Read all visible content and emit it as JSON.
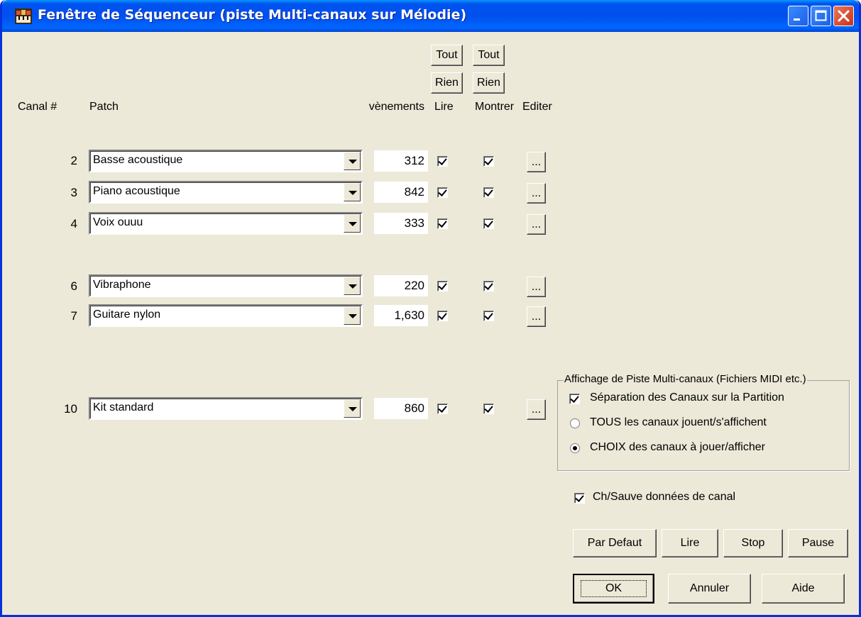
{
  "window": {
    "title": "Fenêtre de Séquenceur (piste Multi-canaux sur Mélodie)"
  },
  "header": {
    "canal": "Canal #",
    "patch": "Patch",
    "events": "vènements",
    "lire": "Lire",
    "montrer": "Montrer",
    "editer": "Editer",
    "tout": "Tout",
    "rien": "Rien"
  },
  "rows": [
    {
      "channel": "2",
      "patch": "Basse acoustique",
      "events": "312",
      "lire": true,
      "montrer": true
    },
    {
      "channel": "3",
      "patch": "Piano acoustique",
      "events": "842",
      "lire": true,
      "montrer": true
    },
    {
      "channel": "4",
      "patch": "Voix ouuu",
      "events": "333",
      "lire": true,
      "montrer": true
    },
    {
      "channel": "6",
      "patch": "Vibraphone",
      "events": "220",
      "lire": true,
      "montrer": true
    },
    {
      "channel": "7",
      "patch": "Guitare nylon",
      "events": "1,630",
      "lire": true,
      "montrer": true
    },
    {
      "channel": "10",
      "patch": "Kit standard",
      "events": "860",
      "lire": true,
      "montrer": true
    }
  ],
  "edit_label": "...",
  "group": {
    "title": "Affichage de Piste Multi-canaux (Fichiers MIDI etc.)",
    "separation": "Séparation des Canaux sur la Partition",
    "separation_checked": true,
    "all_channels": "TOUS les canaux jouent/s'affichent",
    "choice_channels": "CHOIX des canaux à jouer/afficher",
    "selected_option": "choice"
  },
  "save_channel": {
    "label": "Ch/Sauve données de canal",
    "checked": true
  },
  "buttons": {
    "default": "Par Defaut",
    "play": "Lire",
    "stop": "Stop",
    "pause": "Pause",
    "ok": "OK",
    "cancel": "Annuler",
    "help": "Aide"
  },
  "colors": {
    "titlebar": "#0054e3",
    "dialog_bg": "#ece9d8",
    "close_button": "#d6482b"
  }
}
